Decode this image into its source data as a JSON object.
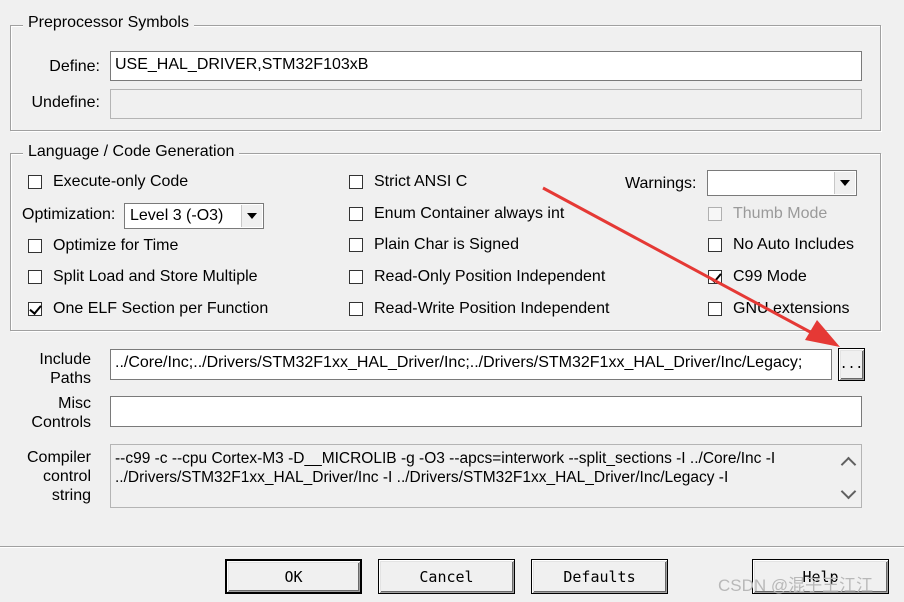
{
  "preprocessor": {
    "legend": "Preprocessor Symbols",
    "define_label": "Define:",
    "define_value": "USE_HAL_DRIVER,STM32F103xB",
    "undefine_label": "Undefine:",
    "undefine_value": ""
  },
  "language": {
    "legend": "Language / Code Generation",
    "execute_only": {
      "label": "Execute-only Code",
      "checked": false
    },
    "optimization_label": "Optimization:",
    "optimization_value": "Level 3 (-O3)",
    "optimize_time": {
      "label": "Optimize for Time",
      "checked": false
    },
    "split_load": {
      "label": "Split Load and Store Multiple",
      "checked": false
    },
    "one_elf": {
      "label": "One ELF Section per Function",
      "checked": true
    },
    "strict_ansi": {
      "label": "Strict ANSI C",
      "checked": false
    },
    "enum_container": {
      "label": "Enum Container always int",
      "checked": false
    },
    "plain_char": {
      "label": "Plain Char is Signed",
      "checked": false
    },
    "ro_pos": {
      "label": "Read-Only Position Independent",
      "checked": false
    },
    "rw_pos": {
      "label": "Read-Write Position Independent",
      "checked": false
    },
    "warnings_label": "Warnings:",
    "warnings_value": "",
    "thumb_mode": {
      "label": "Thumb Mode",
      "checked": false,
      "disabled": true
    },
    "no_auto_includes": {
      "label": "No Auto Includes",
      "checked": false
    },
    "c99_mode": {
      "label": "C99 Mode",
      "checked": true
    },
    "gnu_extensions": {
      "label": "GNU extensions",
      "checked": false
    }
  },
  "include": {
    "label_line1": "Include",
    "label_line2": "Paths",
    "value": "../Core/Inc;../Drivers/STM32F1xx_HAL_Driver/Inc;../Drivers/STM32F1xx_HAL_Driver/Inc/Legacy;",
    "browse_label": "..."
  },
  "misc": {
    "label_line1": "Misc",
    "label_line2": "Controls",
    "value": ""
  },
  "compiler": {
    "label_line1": "Compiler",
    "label_line2": "control",
    "label_line3": "string",
    "line1": "--c99 -c --cpu Cortex-M3 -D__MICROLIB -g -O3 --apcs=interwork --split_sections -I ../Core/Inc -I",
    "line2": "../Drivers/STM32F1xx_HAL_Driver/Inc -I ../Drivers/STM32F1xx_HAL_Driver/Inc/Legacy -I"
  },
  "buttons": {
    "ok": "OK",
    "cancel": "Cancel",
    "defaults": "Defaults",
    "help": "Help"
  },
  "watermark": "CSDN @混子王江江",
  "annotation": {
    "color": "#e53935",
    "description_icon": "red-arrow"
  }
}
